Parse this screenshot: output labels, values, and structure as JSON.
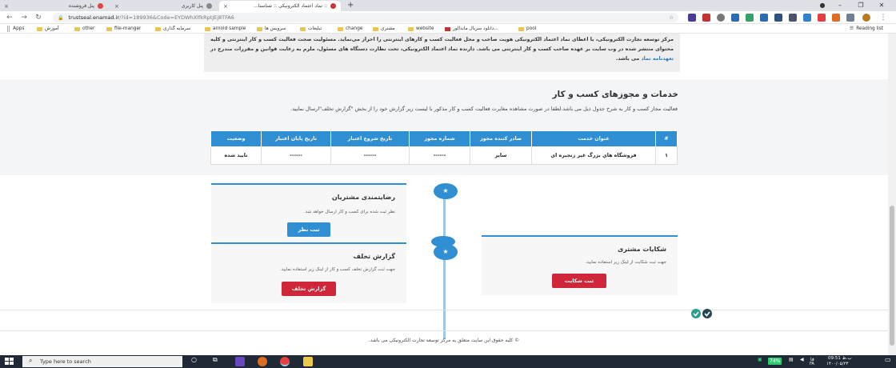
{
  "browser": {
    "tabs": [
      {
        "title": "پنل فروشنده",
        "active": false
      },
      {
        "title": "پنل کاربری",
        "active": false
      },
      {
        "title": ":: نماد اعتماد الکترونیکی :: شناسنا...",
        "active": true
      }
    ],
    "new_tab_label": "+",
    "address": {
      "host": "trustseal.enamad.ir",
      "path": "/?id=189936&Code=EYDWhXlfkRptJEj8TFA6"
    },
    "bookmarks": {
      "apps": "Apps",
      "items": [
        "آموزش",
        "other",
        "file-manger",
        "سرمایه گذاری",
        "arnoid sample",
        "سرویس ها",
        "تبلیغات",
        "change",
        "مشتری",
        "website",
        "دانلود سریال ماندالور...",
        "pool"
      ],
      "reading_list": "Reading list"
    }
  },
  "intro": {
    "text_1": "مرکز توسعه تجارت الکترونیکی، با اعطای نماد اعتماد الکترونیکی هویت صاحب و محل فعالیت کسب و کارهای اینترنتی را احراز می‌نماید. مسئولیت صحت فعالیت کسب و کار اینترنتی و کلیه محتوای منتشر شده در وب سایت بر عهده صاحب کسب و کار اینترنتی می باشد. دارنده نماد اعتماد الکترونیکی، تحت نظارت دستگاه های مسئول، ملزم به رعایت قوانین و مقررات مندرج در",
    "link": "تعهدنامه نماد",
    "text_2": "می باشد."
  },
  "services": {
    "title": "خدمات و مجوزهای کسب و کار",
    "description": "فعالیت مجاز کسب و کار به شرح جدول ذیل می باشد.لطفا در صورت مشاهده مغایرت فعالیت کسب و کار مذکور با لیست زیر گزارش خود را از بخش \"گزارش تخلف\"ارسال نمایید.",
    "table": {
      "headers": [
        "#",
        "عنوان خدمت",
        "صادر کننده مجوز",
        "شماره مجوز",
        "تاریخ شروع اعتبار",
        "تاریخ پایان اعتبار",
        "وضعیت"
      ],
      "rows": [
        [
          "۱",
          "فروشگاه هاي بزرگ غير زنجيره اي",
          "سایر",
          "------",
          "------",
          "------",
          "تایید شده"
        ]
      ]
    }
  },
  "cards": {
    "satisfaction": {
      "title": "رضایتمندی مشتریان",
      "desc": "نظر ثبت شده برای کسب و کار ارسال خواهد شد.",
      "button": "ثبت نظر"
    },
    "complaint": {
      "title": "شکایات مشتری",
      "desc": "جهت ثبت شکایت از لینک زیر استفاده نمایید.",
      "button": "ثبت شکایت"
    },
    "violation": {
      "title": "گزارش تخلف",
      "desc": "جهت ثبت گزارش تخلف کسب و کار از لینک زیر استفاده نمایید.",
      "button": "گزارش تخلف"
    },
    "timeline_glyph": "★"
  },
  "footer": {
    "copyright": "© کلیه حقوق این سایت متعلق به مرکز توسعه تجارت الکترونیکی می باشد."
  },
  "taskbar": {
    "search_placeholder": "Type here to search",
    "battery": "74%",
    "lang": "FA",
    "time": "09:51 ب.ظ",
    "date": "۱۴۰۰/۰۵/۲۳",
    "network_label": "فا"
  },
  "colors": {
    "primary": "#2f8fd2",
    "danger": "#d0263a",
    "link": "#2a7bbd"
  }
}
